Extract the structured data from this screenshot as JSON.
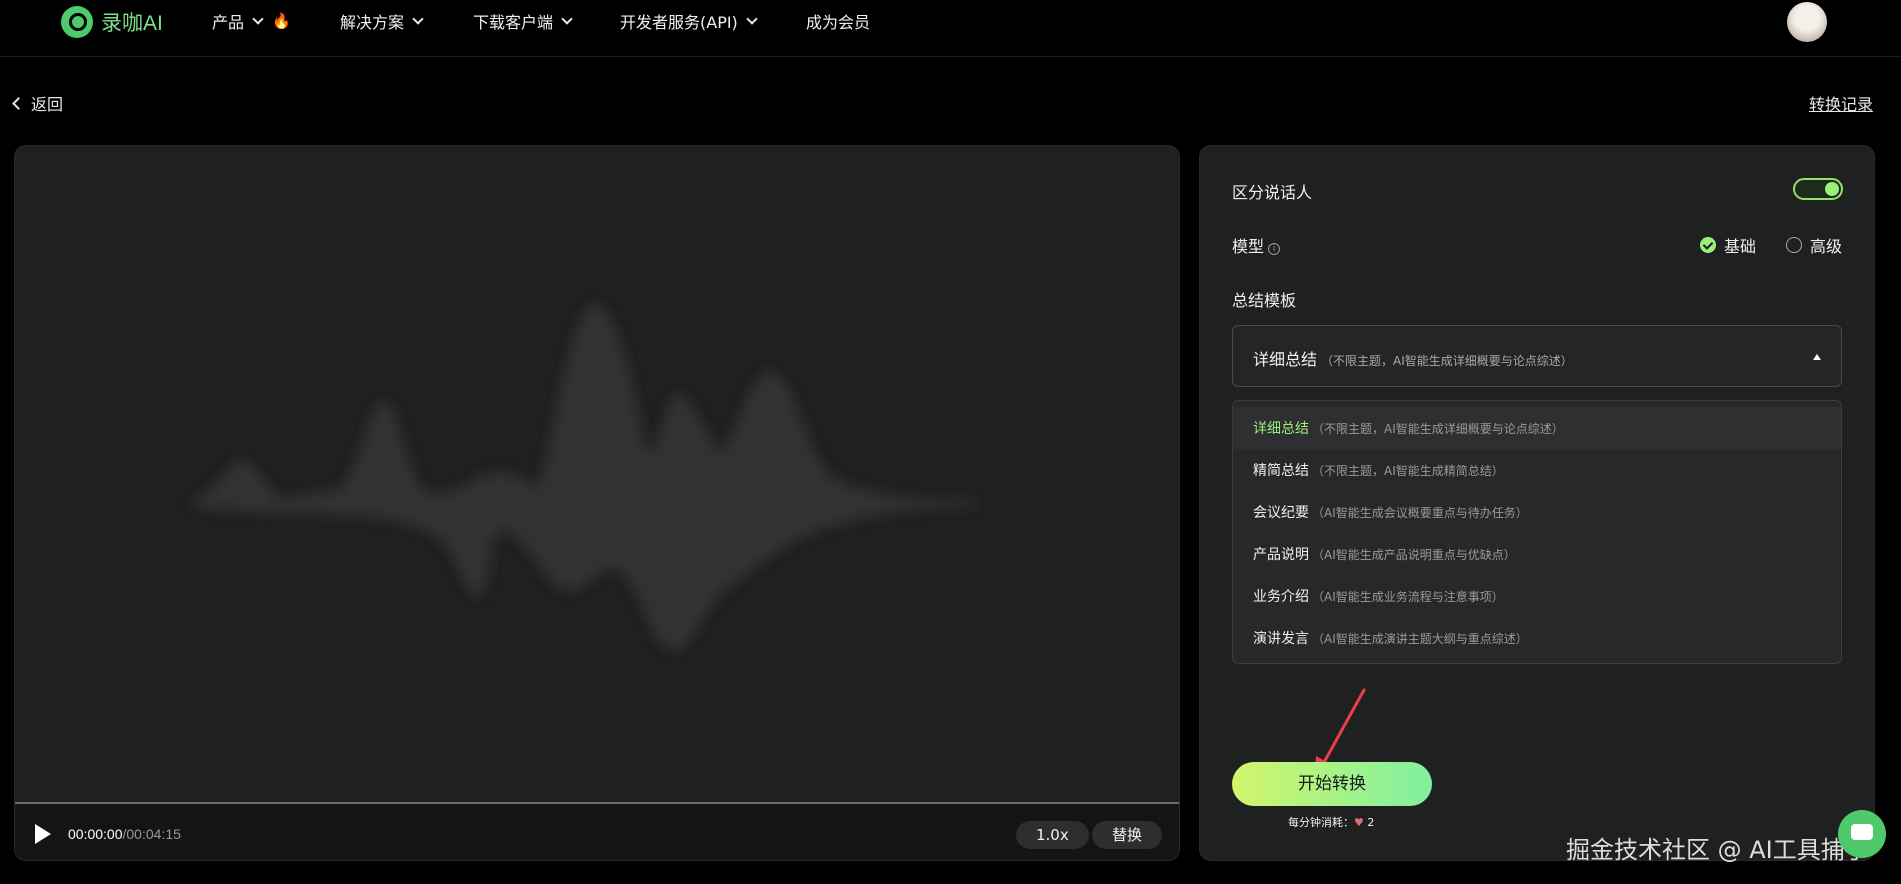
{
  "nav": {
    "logo_text": "录咖AI",
    "items": [
      {
        "label": "产品",
        "has_fire": true
      },
      {
        "label": "解决方案",
        "has_fire": false
      },
      {
        "label": "下载客户端",
        "has_fire": false
      },
      {
        "label": "开发者服务(API)",
        "has_fire": false
      },
      {
        "label": "成为会员",
        "has_fire": false
      }
    ],
    "fire_icon": "🔥"
  },
  "subbar": {
    "back_label": "返回",
    "history_label": "转换记录"
  },
  "player": {
    "current_time": "00:00:00",
    "total_time": "/00:04:15",
    "speed_label": "1.0x",
    "replace_label": "替换",
    "progress": 0
  },
  "settings": {
    "speaker_label": "区分说话人",
    "speaker_enabled": true,
    "model_label": "模型",
    "model_info_icon": "i",
    "model_options": [
      {
        "label": "基础",
        "selected": true
      },
      {
        "label": "高级",
        "selected": false
      }
    ],
    "template_label": "总结模板",
    "selected_template": {
      "title": "详细总结",
      "desc": "（不限主题，AI智能生成详细概要与论点综述）"
    },
    "templates": [
      {
        "title": "详细总结",
        "desc": "（不限主题，AI智能生成详细概要与论点综述）",
        "active": true
      },
      {
        "title": "精简总结",
        "desc": "（不限主题，AI智能生成精简总结）",
        "active": false
      },
      {
        "title": "会议纪要",
        "desc": "（AI智能生成会议概要重点与待办任务）",
        "active": false
      },
      {
        "title": "产品说明",
        "desc": "（AI智能生成产品说明重点与优缺点）",
        "active": false
      },
      {
        "title": "业务介绍",
        "desc": "（AI智能生成业务流程与注意事项）",
        "active": false
      },
      {
        "title": "演讲发言",
        "desc": "（AI智能生成演讲主题大纲与重点综述）",
        "active": false
      }
    ],
    "start_label": "开始转换",
    "cost_label": "每分钟消耗：",
    "cost_icon": "♥",
    "cost_value": "2"
  },
  "colors": {
    "accent": "#9af07a",
    "brand": "#4ec96b",
    "button_gradient_start": "#d3f56c",
    "button_gradient_end": "#7ff0a0"
  },
  "watermark": "掘金技术社区 @ AI工具捕手"
}
